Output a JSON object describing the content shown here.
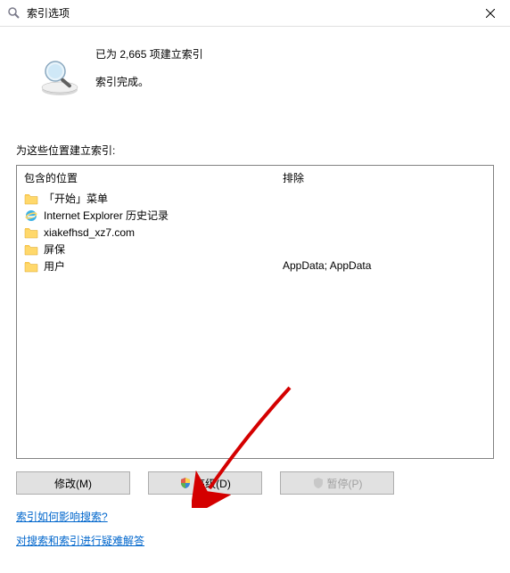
{
  "titlebar": {
    "title": "索引选项"
  },
  "status": {
    "line1": "已为 2,665 项建立索引",
    "line2": "索引完成。"
  },
  "section_label": "为这些位置建立索引:",
  "columns": {
    "included_header": "包含的位置",
    "excluded_header": "排除"
  },
  "locations": [
    {
      "icon": "folder",
      "name": "「开始」菜单",
      "exclude": ""
    },
    {
      "icon": "ie",
      "name": "Internet Explorer 历史记录",
      "exclude": ""
    },
    {
      "icon": "folder",
      "name": "xiakefhsd_xz7.com",
      "exclude": ""
    },
    {
      "icon": "folder",
      "name": "屏保",
      "exclude": ""
    },
    {
      "icon": "folder",
      "name": "用户",
      "exclude": "AppData; AppData"
    }
  ],
  "buttons": {
    "modify": "修改(M)",
    "advanced": "高级(D)",
    "pause": "暂停(P)"
  },
  "links": {
    "link1": "索引如何影响搜索?",
    "link2": "对搜索和索引进行疑难解答"
  }
}
